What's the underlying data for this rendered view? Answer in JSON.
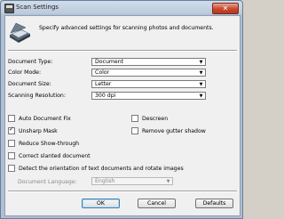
{
  "window": {
    "title": "Scan Settings",
    "close_glyph": "✕"
  },
  "intro": "Specify advanced settings for scanning photos and documents.",
  "fields": [
    {
      "label": "Document Type:",
      "value": "Document"
    },
    {
      "label": "Color Mode:",
      "value": "Color"
    },
    {
      "label": "Document Size:",
      "value": "Letter"
    },
    {
      "label": "Scanning Resolution:",
      "value": "300 dpi"
    }
  ],
  "checkboxes": {
    "auto_document_fix": {
      "label": "Auto Document Fix",
      "checked": false
    },
    "descreen": {
      "label": "Descreen",
      "checked": false
    },
    "unsharp_mask": {
      "label": "Unsharp Mask",
      "checked": true
    },
    "remove_gutter_shadow": {
      "label": "Remove gutter shadow",
      "checked": false
    },
    "reduce_show_through": {
      "label": "Reduce Show-through",
      "checked": false
    },
    "correct_slanted": {
      "label": "Correct slanted document",
      "checked": false
    },
    "detect_orientation": {
      "label": "Detect the orientation of text documents and rotate images",
      "checked": false
    }
  },
  "document_language": {
    "label": "Document Language:",
    "value": "English",
    "enabled": false
  },
  "buttons": {
    "ok": "OK",
    "cancel": "Cancel",
    "defaults": "Defaults"
  },
  "icons": {
    "dropdown": "▼",
    "check": "✓"
  }
}
